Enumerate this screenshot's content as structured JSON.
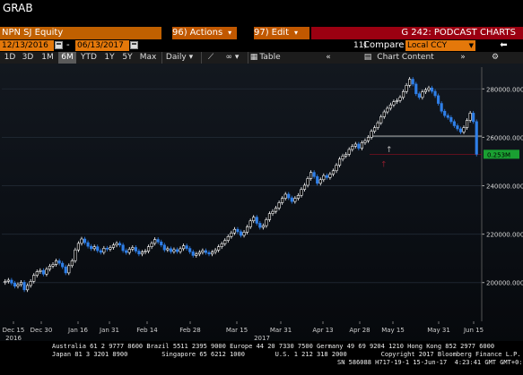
{
  "app_title": "GRAB",
  "menu": {
    "security": "NPN SJ Equity",
    "actions_num": "96)",
    "actions_label": "Actions",
    "edit_num": "97)",
    "edit_label": "Edit",
    "function_title": "G 242: PODCAST CHARTS"
  },
  "range": {
    "start": "12/13/2016",
    "end": "06/13/2017",
    "compare_num": "11)",
    "compare_label": "Compare",
    "currency": "Local CCY"
  },
  "toolbar": {
    "periods": [
      "1D",
      "3D",
      "1M",
      "6M",
      "YTD",
      "1Y",
      "5Y",
      "Max"
    ],
    "selected_period": "6M",
    "frequency": "Daily",
    "table_label": "Table",
    "chart_content_label": "Chart Content"
  },
  "chart_data": {
    "type": "candlestick",
    "y_ticks": [
      "200000.000",
      "220000.000",
      "240000.000",
      "260000.000",
      "280000.000"
    ],
    "ylim": [
      184000,
      289000
    ],
    "last_price_label": "0.253M",
    "last_price": 253000,
    "reference_line": 260500,
    "x_tick_labels": [
      "Dec 15",
      "Dec 30",
      "Jan 16",
      "Jan 31",
      "Feb 14",
      "Feb 28",
      "Mar 15",
      "Mar 31",
      "Apr 13",
      "Apr 28",
      "May 15",
      "May 31",
      "Jun 15"
    ],
    "x_sub_labels": [
      "2016",
      "2017"
    ],
    "accent_up": "#ffffff",
    "accent_down": "#2f7fe8",
    "closes": [
      200500,
      201000,
      199800,
      198500,
      199200,
      200100,
      197000,
      198800,
      200500,
      203000,
      204500,
      205000,
      203500,
      205500,
      206800,
      207500,
      209000,
      208000,
      206500,
      204000,
      207000,
      209000,
      213500,
      216200,
      218000,
      216500,
      215000,
      214000,
      214800,
      213200,
      212500,
      214200,
      213800,
      214500,
      215500,
      216200,
      215500,
      213200,
      212400,
      213800,
      214500,
      213000,
      211800,
      212600,
      213000,
      214800,
      216200,
      217800,
      216800,
      215500,
      213500,
      214000,
      212800,
      213600,
      212800,
      214000,
      215200,
      214100,
      212700,
      211200,
      211800,
      212500,
      213200,
      212400,
      211800,
      212600,
      213400,
      214800,
      216000,
      217400,
      219000,
      220500,
      222000,
      221000,
      219500,
      220800,
      223000,
      225500,
      227000,
      224500,
      222800,
      223500,
      226000,
      228500,
      229400,
      230800,
      233000,
      234800,
      236500,
      235000,
      233500,
      234800,
      236000,
      238500,
      240200,
      243000,
      245500,
      243800,
      241000,
      242500,
      244200,
      243400,
      244800,
      246200,
      248500,
      251000,
      252300,
      253000,
      255000,
      256300,
      257200,
      255500,
      257800,
      258600,
      260000,
      262500,
      264000,
      266000,
      268500,
      270500,
      272000,
      273400,
      274700,
      275200,
      276500,
      278900,
      281500,
      284000,
      282000,
      278000,
      276500,
      278800,
      279600,
      280400,
      279000,
      277200,
      274000,
      270800,
      269000,
      268200,
      266500,
      264800,
      263500,
      262200,
      264000,
      267000,
      270000,
      266500,
      253000
    ]
  },
  "footer": {
    "line1": "Australia 61 2 9777 8600 Brazil 5511 2395 9000 Europe 44 20 7330 7500 Germany 49 69 9204 1210 Hong Kong 852 2977 6000",
    "line2": "Japan 81 3 3201 8900         Singapore 65 6212 1000        U.S. 1 212 318 2000         Copyright 2017 Bloomberg Finance L.P.",
    "line3": "SN 586088 H717-19-1 15-Jun-17  4:23:41 GMT GMT+0:00"
  }
}
